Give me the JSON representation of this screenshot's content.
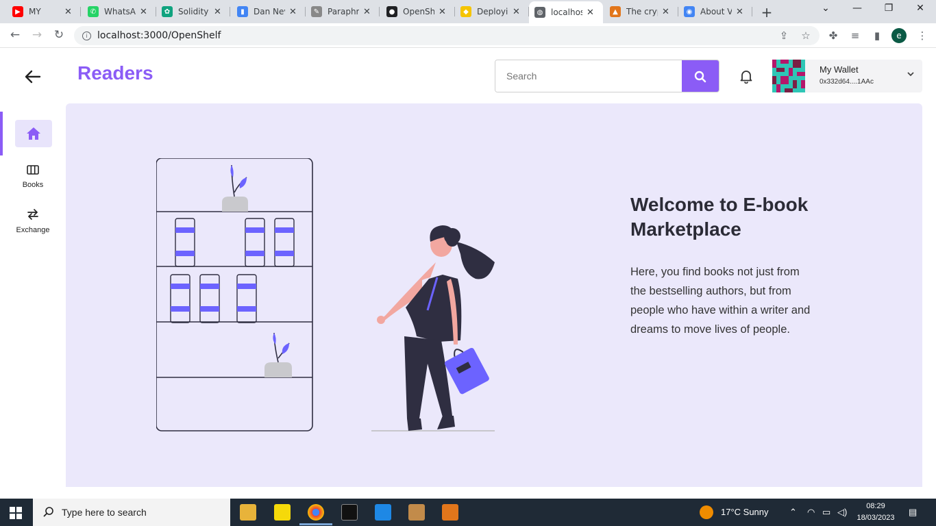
{
  "browser": {
    "tabs": [
      {
        "title": "MY",
        "fav_color": "#ff0000",
        "fav_glyph": "▶"
      },
      {
        "title": "WhatsApp",
        "fav_color": "#25d366",
        "fav_glyph": "✆"
      },
      {
        "title": "Solidity",
        "fav_color": "#10a37f",
        "fav_glyph": "✿"
      },
      {
        "title": "Dan Nev",
        "fav_color": "#4285f4",
        "fav_glyph": "▮"
      },
      {
        "title": "Paraphra",
        "fav_color": "#888888",
        "fav_glyph": "✎"
      },
      {
        "title": "OpenSh",
        "fav_color": "#202124",
        "fav_glyph": "●"
      },
      {
        "title": "Deployin",
        "fav_color": "#f5c400",
        "fav_glyph": "◆"
      },
      {
        "title": "localhos",
        "fav_color": "#5f6368",
        "fav_glyph": "◍"
      },
      {
        "title": "The cryp",
        "fav_color": "#e2761b",
        "fav_glyph": "▲"
      },
      {
        "title": "About V",
        "fav_color": "#4285f4",
        "fav_glyph": "◉"
      }
    ],
    "url": "localhost:3000/OpenShelf",
    "profile_initial": "e"
  },
  "header": {
    "title": "Readers",
    "search_placeholder": "Search"
  },
  "wallet": {
    "name": "My Wallet",
    "address": "0x332d64....1AAc"
  },
  "sidebar": {
    "items": [
      {
        "label": "Books"
      },
      {
        "label": "Exchange"
      }
    ]
  },
  "hero": {
    "heading": "Welcome to E-book Marketplace",
    "text": "Here, you find books not just from the bestselling authors, but from people who have within a writer and dreams to move lives of people."
  },
  "taskbar": {
    "search_placeholder": "Type here to search",
    "weather": "17°C  Sunny",
    "time": "08:29",
    "date": "18/03/2023"
  },
  "colors": {
    "accent": "#8b5cf6",
    "hero_bg": "#ebe8fb"
  }
}
